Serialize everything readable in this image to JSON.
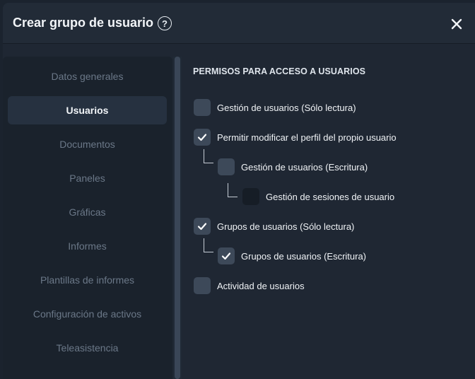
{
  "dialog": {
    "title": "Crear grupo de usuario",
    "help_icon": "?"
  },
  "sidebar": {
    "items": [
      {
        "label": "Datos generales",
        "active": false
      },
      {
        "label": "Usuarios",
        "active": true
      },
      {
        "label": "Documentos",
        "active": false
      },
      {
        "label": "Paneles",
        "active": false
      },
      {
        "label": "Gráficas",
        "active": false
      },
      {
        "label": "Informes",
        "active": false
      },
      {
        "label": "Plantillas de informes",
        "active": false
      },
      {
        "label": "Configuración de activos",
        "active": false
      },
      {
        "label": "Teleasistencia",
        "active": false
      }
    ]
  },
  "permissions": {
    "section_title": "PERMISOS PARA ACCESO A USUARIOS",
    "items": [
      {
        "label": "Gestión de usuarios (Sólo lectura)",
        "checked": false,
        "level": 0
      },
      {
        "label": "Permitir modificar el perfil del propio usuario",
        "checked": true,
        "level": 0
      },
      {
        "label": "Gestión de usuarios (Escritura)",
        "checked": false,
        "level": 1
      },
      {
        "label": "Gestión de sesiones de usuario",
        "checked": false,
        "level": 2
      },
      {
        "label": "Grupos de usuarios (Sólo lectura)",
        "checked": true,
        "level": 0
      },
      {
        "label": "Grupos de usuarios (Escritura)",
        "checked": true,
        "level": 1
      },
      {
        "label": "Actividad de usuarios",
        "checked": false,
        "level": 0
      }
    ]
  },
  "colors": {
    "background": "#1f2733",
    "checkbox": "#3d4959",
    "active_nav": "#263140"
  }
}
